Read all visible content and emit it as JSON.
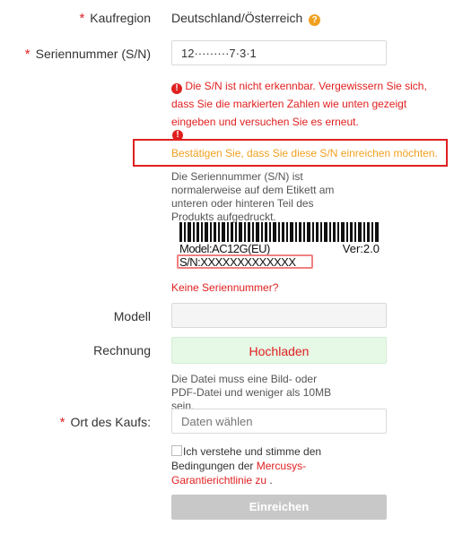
{
  "form": {
    "region": {
      "label": "Kaufregion",
      "value": "Deutschland/Österreich",
      "help_icon": "question-circle-icon"
    },
    "serial": {
      "label": "Seriennummer (S/N)",
      "value": "12·········7·3·1",
      "error_icon": "exclamation-circle-icon",
      "error_text": "Die S/N ist nicht erkennbar. Vergewissern Sie sich, dass Sie die markierten Zahlen wie unten gezeigt eingeben und versuchen Sie es erneut.",
      "confirm_text": "Bestätigen Sie, dass Sie diese S/N einreichen möchten.",
      "hint_text": "Die Seriennummer (S/N) ist normalerweise auf dem Etikett am unteren oder hinteren Teil des Produkts aufgedruckt.",
      "label_model": "Model:AC12G(EU)",
      "label_version": "Ver:2.0",
      "label_sn": "S/N:XXXXXXXXXXXXX",
      "no_serial_link": "Keine Seriennummer?"
    },
    "model": {
      "label": "Modell",
      "value": ""
    },
    "invoice": {
      "label": "Rechnung",
      "upload_button": "Hochladen",
      "hint_text": "Die Datei muss eine Bild- oder PDF-Datei und weniger als 10MB sein."
    },
    "place": {
      "label": "Ort des Kaufs:",
      "placeholder": "Daten wählen"
    },
    "agree": {
      "text_before": "Ich verstehe und stimme den Bedingungen der ",
      "link_text": "Mercusys-Garantierichtlinie zu",
      "text_after": " ."
    },
    "submit_button": "Einreichen",
    "required_marker": "*"
  },
  "colors": {
    "error": "#e02020",
    "warning": "#f0a020",
    "upload_bg": "#e6f8e6",
    "submit_bg": "#c8c8c8"
  }
}
